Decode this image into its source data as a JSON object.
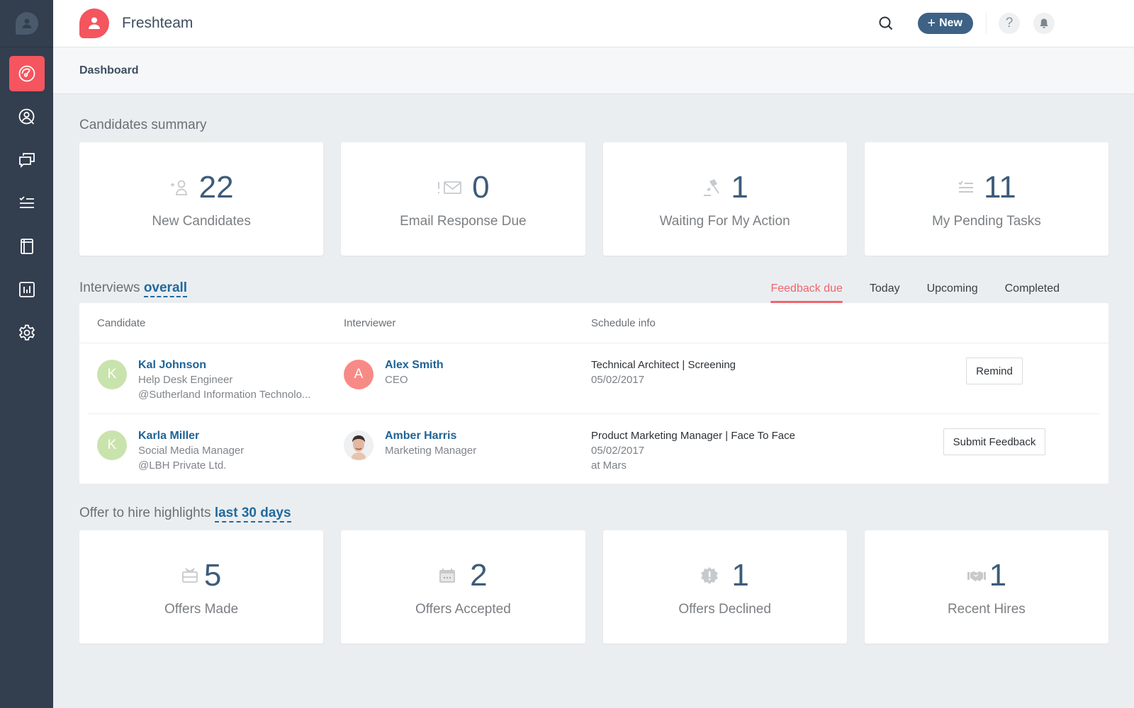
{
  "app": {
    "title": "Freshteam"
  },
  "sidebar": {
    "items": [
      {
        "name": "dashboard",
        "icon": "gauge-icon",
        "active": true
      },
      {
        "name": "candidates",
        "icon": "user-search-icon"
      },
      {
        "name": "interviews",
        "icon": "chat-bubbles-icon"
      },
      {
        "name": "tasks",
        "icon": "checklist-icon"
      },
      {
        "name": "jobs",
        "icon": "book-icon"
      },
      {
        "name": "reports",
        "icon": "bar-chart-icon"
      },
      {
        "name": "settings",
        "icon": "gear-icon"
      }
    ]
  },
  "header": {
    "new_label": "New",
    "help_label": "?"
  },
  "breadcrumb": {
    "current": "Dashboard"
  },
  "candidates_summary": {
    "title": "Candidates summary",
    "cards": [
      {
        "value": "22",
        "label": "New Candidates",
        "icon": "add-user-icon"
      },
      {
        "value": "0",
        "label": "Email Response Due",
        "icon": "email-alert-icon"
      },
      {
        "value": "1",
        "label": "Waiting For My Action",
        "icon": "gavel-icon"
      },
      {
        "value": "11",
        "label": "My Pending Tasks",
        "icon": "checklist-icon"
      }
    ]
  },
  "interviews": {
    "title": "Interviews",
    "filter": "overall",
    "tabs": [
      {
        "label": "Feedback due",
        "active": true
      },
      {
        "label": "Today"
      },
      {
        "label": "Upcoming"
      },
      {
        "label": "Completed"
      }
    ],
    "columns": [
      "Candidate",
      "Interviewer",
      "Schedule info"
    ],
    "rows": [
      {
        "candidate": {
          "initial": "K",
          "name": "Kal Johnson",
          "role": "Help Desk Engineer",
          "company": "@Sutherland Information Technolo..."
        },
        "interviewer": {
          "initial": "A",
          "name": "Alex Smith",
          "role": "CEO"
        },
        "schedule": {
          "title": "Technical Architect | Screening",
          "date": "05/02/2017",
          "location": ""
        },
        "action": "Remind"
      },
      {
        "candidate": {
          "initial": "K",
          "name": "Karla Miller",
          "role": "Social Media Manager",
          "company": "@LBH Private Ltd."
        },
        "interviewer": {
          "initial": "",
          "name": "Amber Harris",
          "role": "Marketing Manager"
        },
        "schedule": {
          "title": "Product Marketing Manager | Face To Face",
          "date": "05/02/2017",
          "location": "at Mars"
        },
        "action": "Submit Feedback"
      }
    ]
  },
  "offers": {
    "title": "Offer to hire highlights",
    "filter": "last 30 days",
    "cards": [
      {
        "value": "5",
        "label": "Offers Made",
        "icon": "gift-card-icon"
      },
      {
        "value": "2",
        "label": "Offers Accepted",
        "icon": "calendar-icon"
      },
      {
        "value": "1",
        "label": "Offers Declined",
        "icon": "alert-badge-icon"
      },
      {
        "value": "1",
        "label": "Recent Hires",
        "icon": "handshake-icon"
      }
    ]
  },
  "colors": {
    "brand": "#f4555e",
    "sidebar": "#333e4e",
    "primary_button": "#3d6285",
    "link": "#1e6396",
    "active_tab": "#f0656c"
  }
}
